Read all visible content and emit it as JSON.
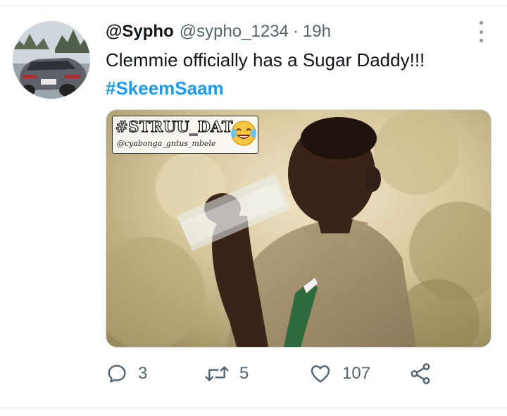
{
  "tweet": {
    "display_name": "@Sypho",
    "handle": "@sypho_1234",
    "separator": "·",
    "time": "19h",
    "text": "Clemmie officially has a Sugar Daddy!!!",
    "hashtag": "#SkeemSaam"
  },
  "media": {
    "watermark_title": "#STRUU_DAT",
    "watermark_subtitle": "@cyabonga_gntus_mbele",
    "emoji": "face-with-tears-of-joy"
  },
  "actions": {
    "replies": "3",
    "retweets": "5",
    "likes": "107"
  },
  "colors": {
    "hashtag": "#1d9bf0",
    "secondary_text": "#536471"
  }
}
